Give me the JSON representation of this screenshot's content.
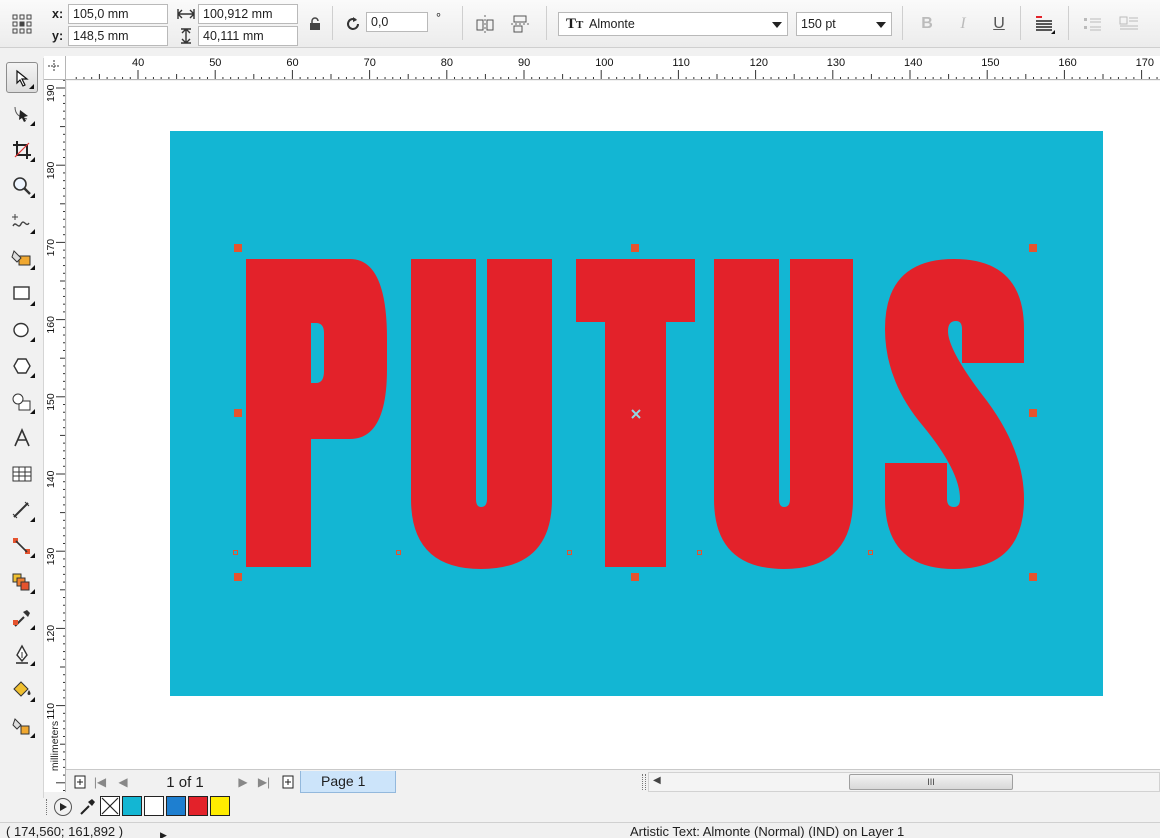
{
  "property_bar": {
    "x_label": "x:",
    "x_value": "105,0 mm",
    "y_label": "y:",
    "y_value": "148,5 mm",
    "width_value": "100,912 mm",
    "height_value": "40,111 mm",
    "rotation_value": "0,0",
    "rotation_unit": "°",
    "font_name": "Almonte",
    "font_size": "150 pt"
  },
  "rulers": {
    "top_ticks": [
      "40",
      "50",
      "60",
      "70",
      "80",
      "90",
      "100",
      "110",
      "120",
      "130",
      "140",
      "150",
      "160",
      "170"
    ],
    "left_ticks": [
      "190",
      "180",
      "170",
      "160",
      "150",
      "140",
      "130",
      "120",
      "110"
    ],
    "unit_label": "millimeters"
  },
  "canvas": {
    "text_content": "PUTUS",
    "background_color": "#13b6d3",
    "text_color": "#e3222a"
  },
  "page_nav": {
    "page_count": "1 of 1",
    "page_tab_label": "Page 1"
  },
  "palette": {
    "colors": [
      "#13b6d3",
      "#ffffff",
      "#1e7fd0",
      "#e3222a",
      "#ffec00"
    ]
  },
  "status": {
    "cursor_coords": "( 174,560; 161,892 )",
    "object_info": "Artistic Text: Almonte (Normal) (IND) on Layer 1"
  }
}
